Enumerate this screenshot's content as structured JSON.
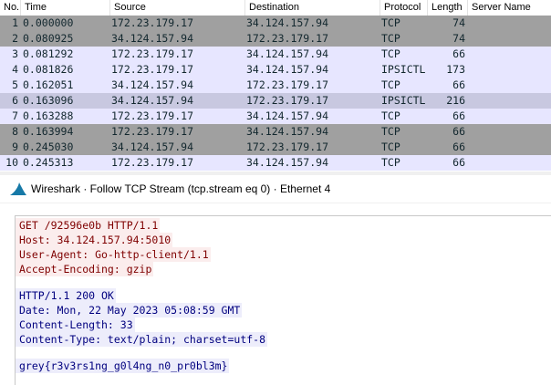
{
  "packet_list": {
    "columns": [
      "No.",
      "Time",
      "Source",
      "Destination",
      "Protocol",
      "Length",
      "Server Name"
    ],
    "rows": [
      {
        "no": "1",
        "time": "0.000000",
        "src": "172.23.179.17",
        "dst": "34.124.157.94",
        "proto": "TCP",
        "len": "74",
        "srv": "",
        "style": "dark"
      },
      {
        "no": "2",
        "time": "0.080925",
        "src": "34.124.157.94",
        "dst": "172.23.179.17",
        "proto": "TCP",
        "len": "74",
        "srv": "",
        "style": "dark"
      },
      {
        "no": "3",
        "time": "0.081292",
        "src": "172.23.179.17",
        "dst": "34.124.157.94",
        "proto": "TCP",
        "len": "66",
        "srv": "",
        "style": "light"
      },
      {
        "no": "4",
        "time": "0.081826",
        "src": "172.23.179.17",
        "dst": "34.124.157.94",
        "proto": "IPSICTL",
        "len": "173",
        "srv": "",
        "style": "light"
      },
      {
        "no": "5",
        "time": "0.162051",
        "src": "34.124.157.94",
        "dst": "172.23.179.17",
        "proto": "TCP",
        "len": "66",
        "srv": "",
        "style": "light"
      },
      {
        "no": "6",
        "time": "0.163096",
        "src": "34.124.157.94",
        "dst": "172.23.179.17",
        "proto": "IPSICTL",
        "len": "216",
        "srv": "",
        "style": "selected"
      },
      {
        "no": "7",
        "time": "0.163288",
        "src": "172.23.179.17",
        "dst": "34.124.157.94",
        "proto": "TCP",
        "len": "66",
        "srv": "",
        "style": "light"
      },
      {
        "no": "8",
        "time": "0.163994",
        "src": "172.23.179.17",
        "dst": "34.124.157.94",
        "proto": "TCP",
        "len": "66",
        "srv": "",
        "style": "dark"
      },
      {
        "no": "9",
        "time": "0.245030",
        "src": "34.124.157.94",
        "dst": "172.23.179.17",
        "proto": "TCP",
        "len": "66",
        "srv": "",
        "style": "dark"
      },
      {
        "no": "10",
        "time": "0.245313",
        "src": "172.23.179.17",
        "dst": "34.124.157.94",
        "proto": "TCP",
        "len": "66",
        "srv": "",
        "style": "light"
      }
    ]
  },
  "stream_window": {
    "title": "Wireshark · Follow TCP Stream (tcp.stream eq 0) · Ethernet 4",
    "icon": "wireshark-fin-icon",
    "client_lines": [
      "GET /92596e0b HTTP/1.1",
      "Host: 34.124.157.94:5010",
      "User-Agent: Go-http-client/1.1",
      "Accept-Encoding: gzip"
    ],
    "server_lines": [
      "HTTP/1.1 200 OK",
      "Date: Mon, 22 May 2023 05:08:59 GMT",
      "Content-Length: 33",
      "Content-Type: text/plain; charset=utf-8"
    ],
    "server_body": "grey{r3v3rs1ng_g0l4ng_n0_pr0bl3m}"
  },
  "colors": {
    "row_dark": "#a0a0a0",
    "row_light": "#e7e6ff",
    "row_selected": "#c8c8e0",
    "client_text": "#7f0000",
    "client_bg": "#fbeded",
    "server_text": "#00007f",
    "server_bg": "#ededfb",
    "fin_icon": "#1679a7"
  }
}
